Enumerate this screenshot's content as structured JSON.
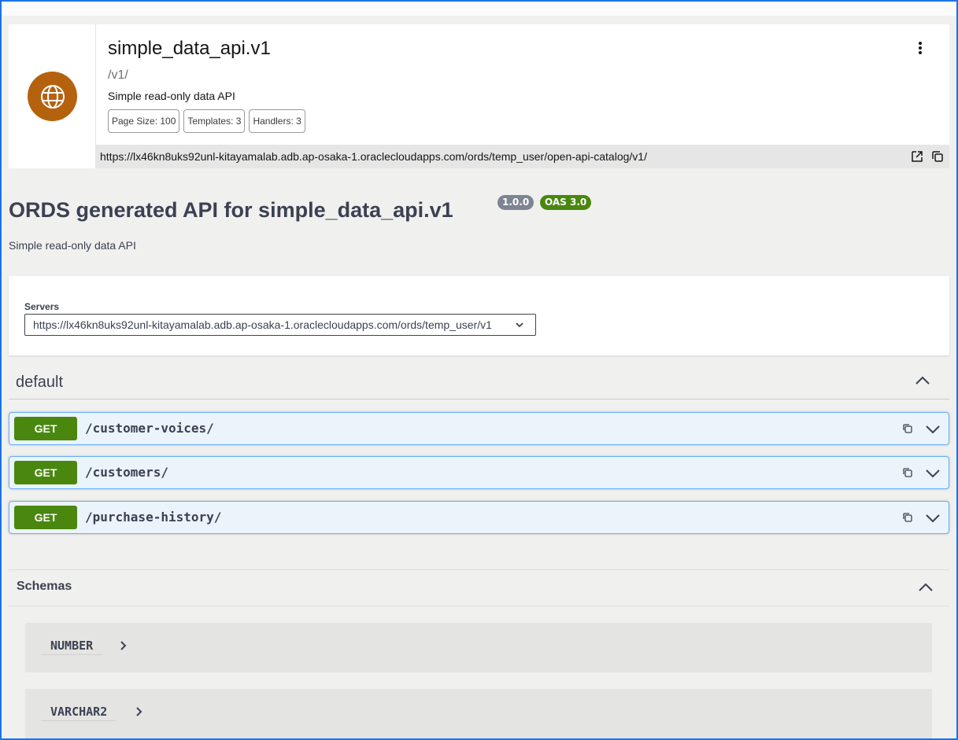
{
  "header_card": {
    "title": "simple_data_api.v1",
    "path": "/v1/",
    "description": "Simple read-only data API",
    "chips": [
      "Page Size: 100",
      "Templates: 3",
      "Handlers: 3"
    ],
    "url": "https://lx46kn8uks92unl-kitayamalab.adb.ap-osaka-1.oraclecloudapps.com/ords/temp_user/open-api-catalog/v1/",
    "icon": "globe-icon",
    "icon_color": "#b5620f"
  },
  "info": {
    "title": "ORDS generated API for simple_data_api.v1",
    "version": "1.0.0",
    "oas": "OAS 3.0",
    "description": "Simple read-only data API"
  },
  "servers": {
    "label": "Servers",
    "selected": "https://lx46kn8uks92unl-kitayamalab.adb.ap-osaka-1.oraclecloudapps.com/ords/temp_user/v1"
  },
  "tag": {
    "name": "default"
  },
  "operations": [
    {
      "method": "GET",
      "path": "/customer-voices/"
    },
    {
      "method": "GET",
      "path": "/customers/"
    },
    {
      "method": "GET",
      "path": "/purchase-history/"
    }
  ],
  "schemas": {
    "title": "Schemas",
    "models": [
      "NUMBER",
      "VARCHAR2"
    ]
  },
  "colors": {
    "get": "#49870f",
    "op_border": "#61affe",
    "op_bg": "#ebf3fb",
    "badge_version": "#7d8492",
    "badge_oas": "#49870f"
  }
}
